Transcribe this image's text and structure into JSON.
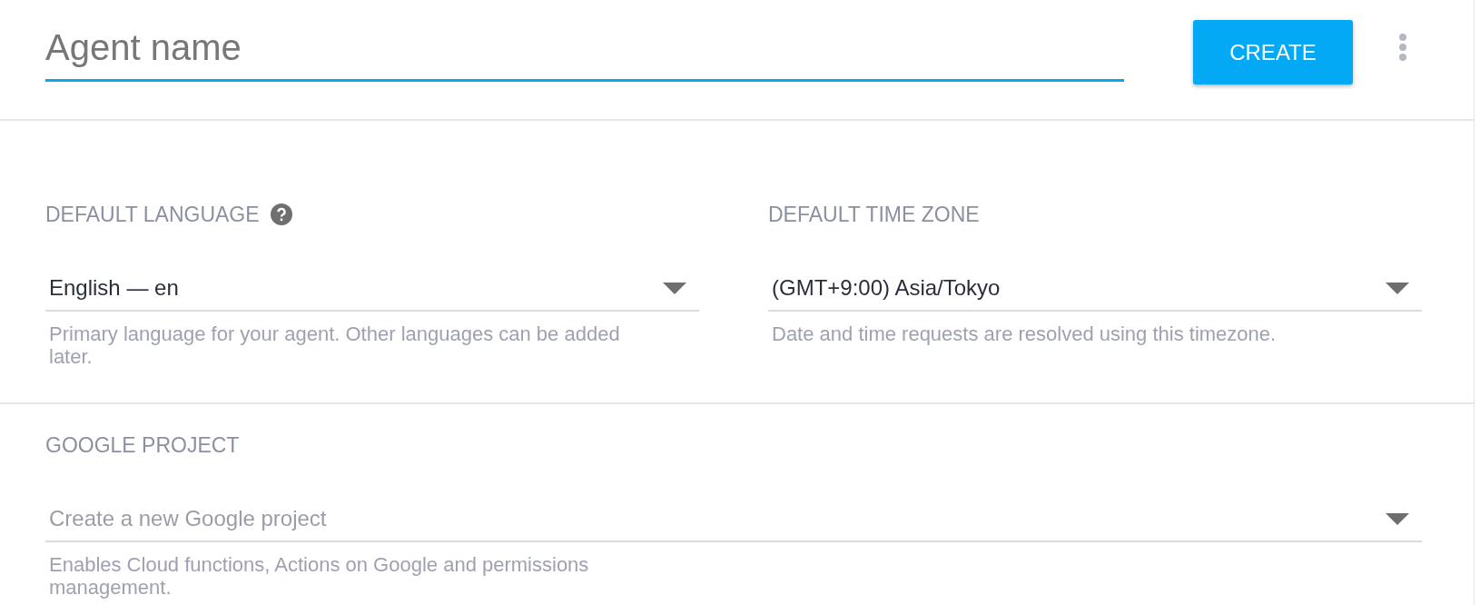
{
  "header": {
    "agent_name": {
      "placeholder": "Agent name"
    },
    "create_button": "CREATE"
  },
  "settings": [
    {
      "label": "DEFAULT LANGUAGE",
      "help": true,
      "value": "English — en",
      "hint": "Primary language for your agent. Other languages can be added later."
    },
    {
      "label": "DEFAULT TIME ZONE",
      "help": false,
      "value": "(GMT+9:00) Asia/Tokyo",
      "hint": "Date and time requests are resolved using this timezone."
    }
  ],
  "google_project": {
    "label": "GOOGLE PROJECT",
    "placeholder": "Create a new Google project",
    "hint": "Enables Cloud functions, Actions on Google and permissions management."
  }
}
